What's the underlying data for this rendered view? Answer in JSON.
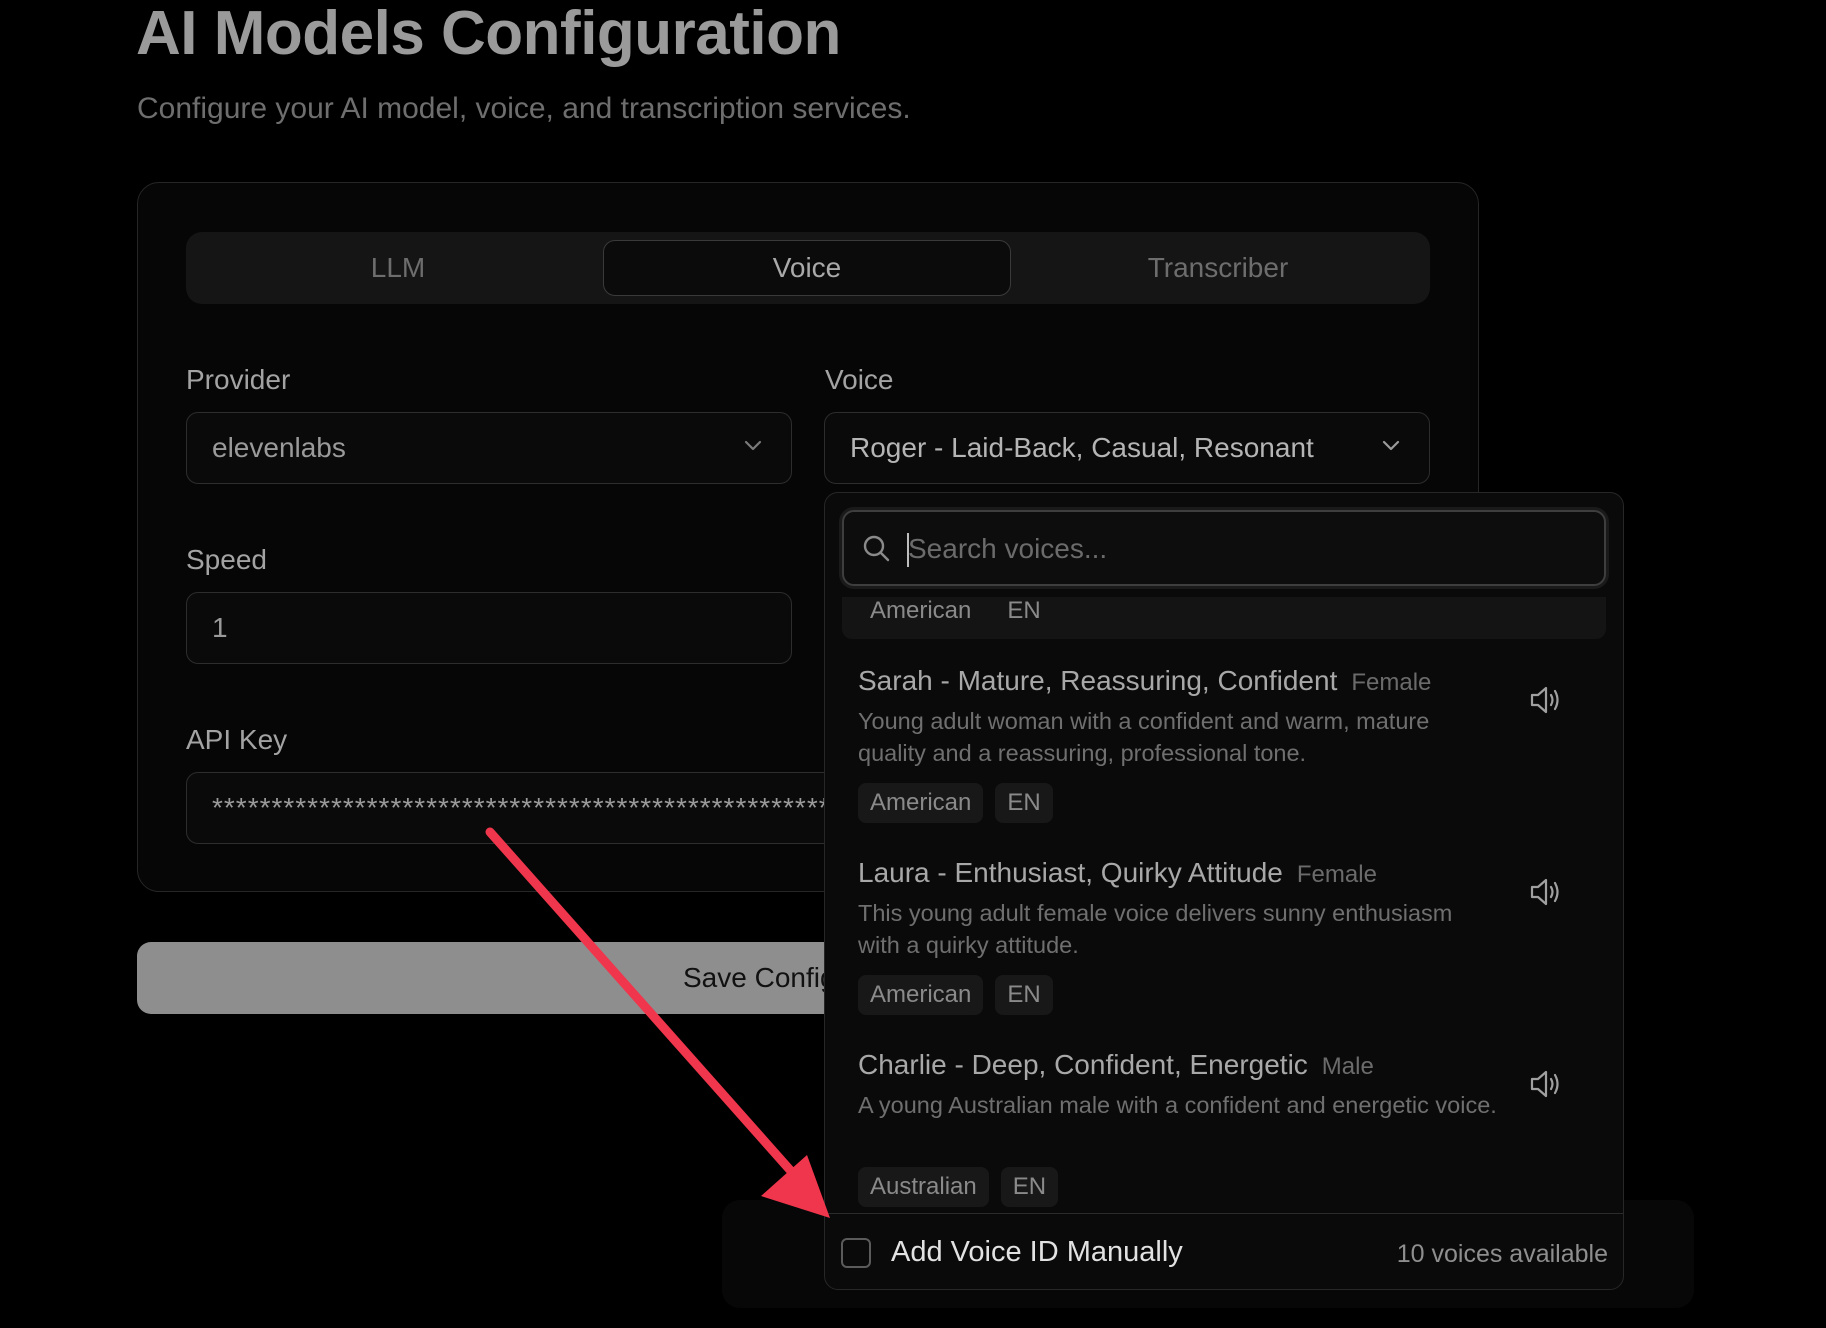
{
  "header": {
    "title": "AI Models Configuration",
    "subtitle": "Configure your AI model, voice, and transcription services."
  },
  "tabs": [
    {
      "label": "LLM",
      "active": false
    },
    {
      "label": "Voice",
      "active": true
    },
    {
      "label": "Transcriber",
      "active": false
    }
  ],
  "form": {
    "provider_label": "Provider",
    "provider_value": "elevenlabs",
    "voice_label": "Voice",
    "voice_value": "Roger - Laid-Back, Casual, Resonant",
    "speed_label": "Speed",
    "speed_value": "1",
    "api_key_label": "API Key",
    "api_key_value": "********************************************************************************"
  },
  "save_button": {
    "label": "Save Configuration"
  },
  "voice_dropdown": {
    "search_placeholder": "Search voices...",
    "partial_item_tags": [
      "American",
      "EN"
    ],
    "voices": [
      {
        "name": "Sarah - Mature, Reassuring, Confident",
        "gender": "Female",
        "description": "Young adult woman with a confident and warm, mature quality and a reassuring, professional tone.",
        "tags": [
          "American",
          "EN"
        ]
      },
      {
        "name": "Laura - Enthusiast, Quirky Attitude",
        "gender": "Female",
        "description": "This young adult female voice delivers sunny enthusiasm with a quirky attitude.",
        "tags": [
          "American",
          "EN"
        ]
      },
      {
        "name": "Charlie - Deep, Confident, Energetic",
        "gender": "Male",
        "description": "A young Australian male with a confident and energetic voice.",
        "tags": [
          "Australian",
          "EN"
        ]
      }
    ],
    "add_manual_label": "Add Voice ID Manually",
    "add_manual_checked": false,
    "voices_count_text": "10 voices available"
  },
  "icons": {
    "chevron": "chevron-down-icon",
    "search": "search-icon",
    "speaker": "speaker-icon"
  },
  "colors": {
    "annotation_arrow": "#f0364c",
    "background": "#000000"
  }
}
